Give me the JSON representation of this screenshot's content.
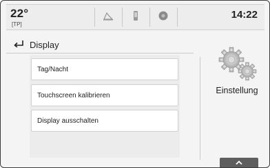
{
  "status_bar": {
    "temperature": "22°",
    "temperature_sub": "[TP]",
    "time": "14:22",
    "tabs": [
      {
        "icon": "media-icon"
      },
      {
        "icon": "phone-icon"
      },
      {
        "icon": "info-icon"
      }
    ]
  },
  "header": {
    "back_icon": "back-arrow-icon",
    "title": "Display"
  },
  "menu": {
    "items": [
      {
        "label": "Tag/Nacht"
      },
      {
        "label": "Touchscreen kalibrieren"
      },
      {
        "label": "Display ausschalten"
      }
    ]
  },
  "side_panel": {
    "icon": "gears-icon",
    "label": "Einstellung"
  },
  "bottom_handle": {
    "icon": "chevron-up-icon"
  },
  "colors": {
    "background": "#f4f4f4",
    "item_background": "#ffffff",
    "handle": "#5e5e5e",
    "text": "#222222"
  }
}
